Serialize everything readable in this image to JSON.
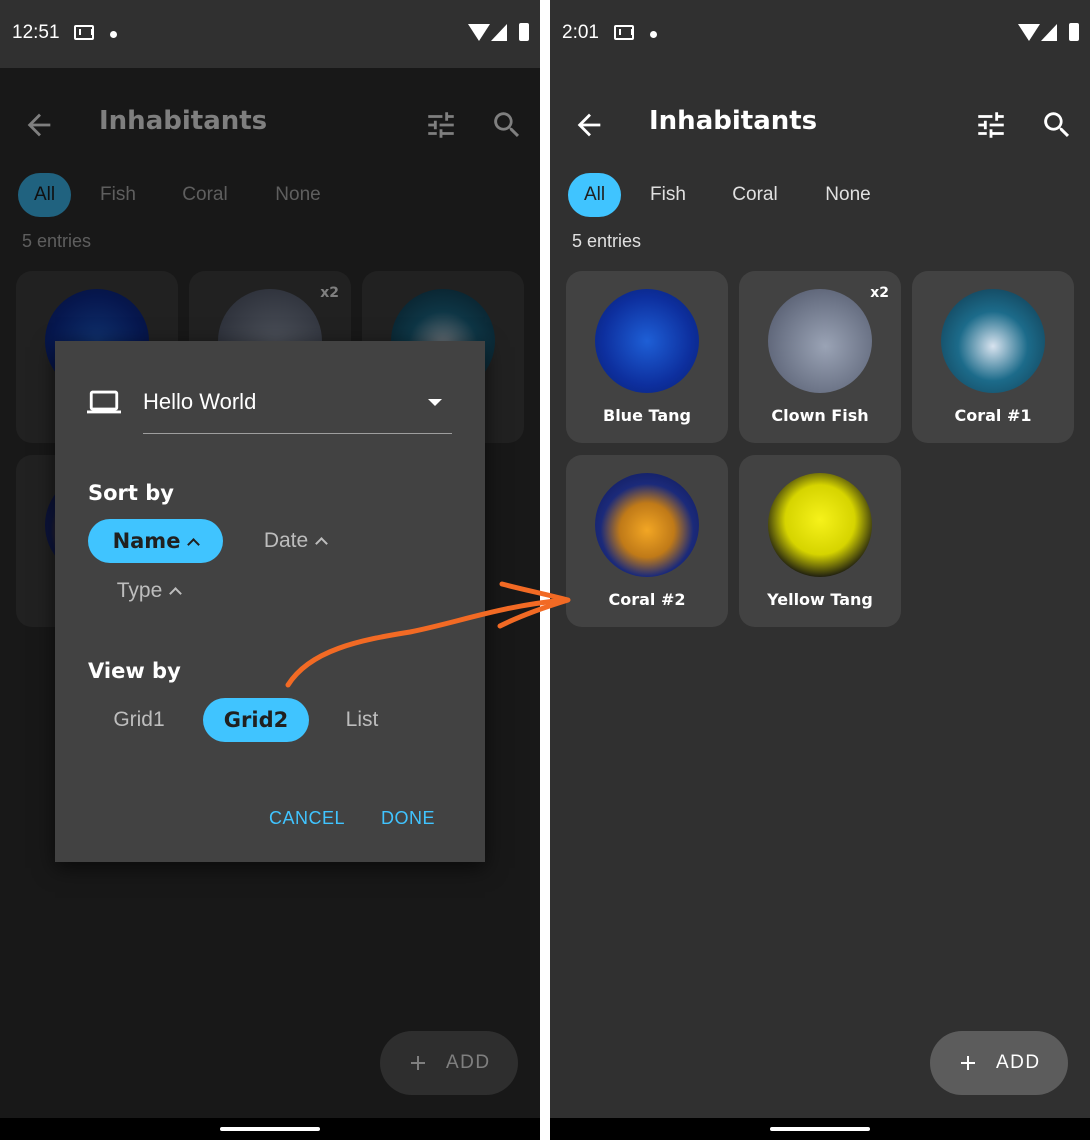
{
  "left": {
    "status": {
      "time": "12:51"
    },
    "appbar": {
      "title": "Inhabitants"
    },
    "chips": [
      {
        "label": "All"
      },
      {
        "label": "Fish"
      },
      {
        "label": "Coral"
      },
      {
        "label": "None"
      }
    ],
    "entries": "5 entries",
    "cards": [
      {
        "label": "",
        "count": ""
      },
      {
        "label": "",
        "count": "x2"
      },
      {
        "label": "",
        "count": ""
      }
    ],
    "fab": {
      "label": "ADD"
    },
    "dialog": {
      "device": "Hello World",
      "sort_title": "Sort by",
      "sort_options": [
        {
          "label": "Name",
          "selected": true
        },
        {
          "label": "Date",
          "selected": false
        },
        {
          "label": "Type",
          "selected": false
        }
      ],
      "view_title": "View by",
      "view_options": [
        {
          "label": "Grid1",
          "selected": false
        },
        {
          "label": "Grid2",
          "selected": true
        },
        {
          "label": "List",
          "selected": false
        }
      ],
      "cancel": "CANCEL",
      "done": "DONE"
    }
  },
  "right": {
    "status": {
      "time": "2:01"
    },
    "appbar": {
      "title": "Inhabitants"
    },
    "chips": [
      {
        "label": "All"
      },
      {
        "label": "Fish"
      },
      {
        "label": "Coral"
      },
      {
        "label": "None"
      }
    ],
    "entries": "5 entries",
    "cards": [
      {
        "label": "Blue Tang",
        "count": ""
      },
      {
        "label": "Clown Fish",
        "count": "x2"
      },
      {
        "label": "Coral #1",
        "count": ""
      },
      {
        "label": "Coral #2",
        "count": ""
      },
      {
        "label": "Yellow Tang",
        "count": ""
      }
    ],
    "fab": {
      "label": "ADD"
    }
  },
  "colors": {
    "accent": "#40c4ff",
    "background": "#303030",
    "card": "#424242",
    "annotation": "#f26a24"
  }
}
